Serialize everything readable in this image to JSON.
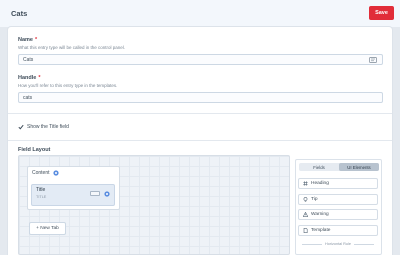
{
  "header": {
    "title": "Cats",
    "save_label": "Save"
  },
  "name_field": {
    "label": "Name",
    "required_mark": "*",
    "hint": "What this entry type will be called in the control panel.",
    "value": "Cats"
  },
  "handle_field": {
    "label": "Handle",
    "required_mark": "*",
    "hint": "How you'll refer to this entry type in the templates.",
    "value": "cats"
  },
  "title_toggle": {
    "label": "Show the Title field",
    "checked": true
  },
  "field_layout": {
    "label": "Field Layout",
    "tab": {
      "name": "Content",
      "fields": [
        {
          "name": "Title",
          "handle": "TITLE"
        }
      ]
    },
    "new_tab_label": "+ New Tab"
  },
  "sidebar": {
    "tabs": [
      {
        "label": "Fields",
        "active": false
      },
      {
        "label": "UI Elements",
        "active": true
      }
    ],
    "elements": [
      {
        "label": "Heading",
        "icon": "hash-icon"
      },
      {
        "label": "Tip",
        "icon": "lightbulb-icon"
      },
      {
        "label": "Warning",
        "icon": "warning-icon"
      },
      {
        "label": "Template",
        "icon": "document-icon"
      }
    ],
    "horizontal_rule_label": "Horizontal Rule"
  },
  "colors": {
    "accent": "#e12d39",
    "gear": "#5a8de0"
  }
}
